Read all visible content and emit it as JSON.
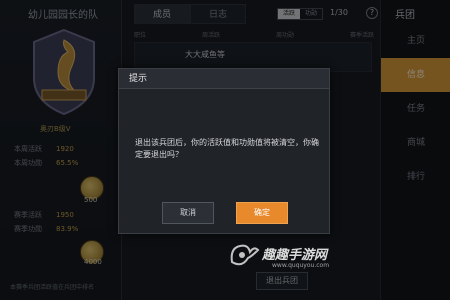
{
  "left_panel": {
    "team_title": "幼儿园园长的队",
    "rank_label": "奥刃B级V",
    "stats": [
      {
        "label": "本周活跃",
        "value": "1920"
      },
      {
        "label": "本周功勋",
        "value": "65.5%"
      }
    ],
    "coins": [
      "500",
      "4000"
    ],
    "stats2": [
      {
        "label": "赛季活跃",
        "value": "1950"
      },
      {
        "label": "赛季功勋",
        "value": "83.9%"
      }
    ],
    "bottom_hint": "本赛季兵团活跃值在兵团中排名"
  },
  "middle_panel": {
    "tabs": [
      "成员",
      "日志"
    ],
    "toggle": [
      "活跃",
      "功勋"
    ],
    "member_count": "1/30",
    "help_icon": "?",
    "list_headers": [
      "职位",
      "周活跃",
      "周功勋",
      "赛季活跃"
    ],
    "member_name": "大大咸鱼等",
    "leave_button": "退出兵团"
  },
  "right_panel": {
    "title": "兵团",
    "nav": [
      "主页",
      "信息",
      "任务",
      "商城",
      "排行"
    ],
    "active_index": 1
  },
  "dialog": {
    "title": "提示",
    "message": "退出该兵团后，你的活跃值和功勋值将被清空，你确定要退出吗？",
    "cancel_label": "取消",
    "confirm_label": "确定"
  },
  "watermark": {
    "text": "趣趣手游网",
    "url": "www.ququyou.com"
  },
  "colors": {
    "accent": "#e8892c",
    "nav_active": "#d89a3a",
    "panel_bg": "#202328"
  }
}
